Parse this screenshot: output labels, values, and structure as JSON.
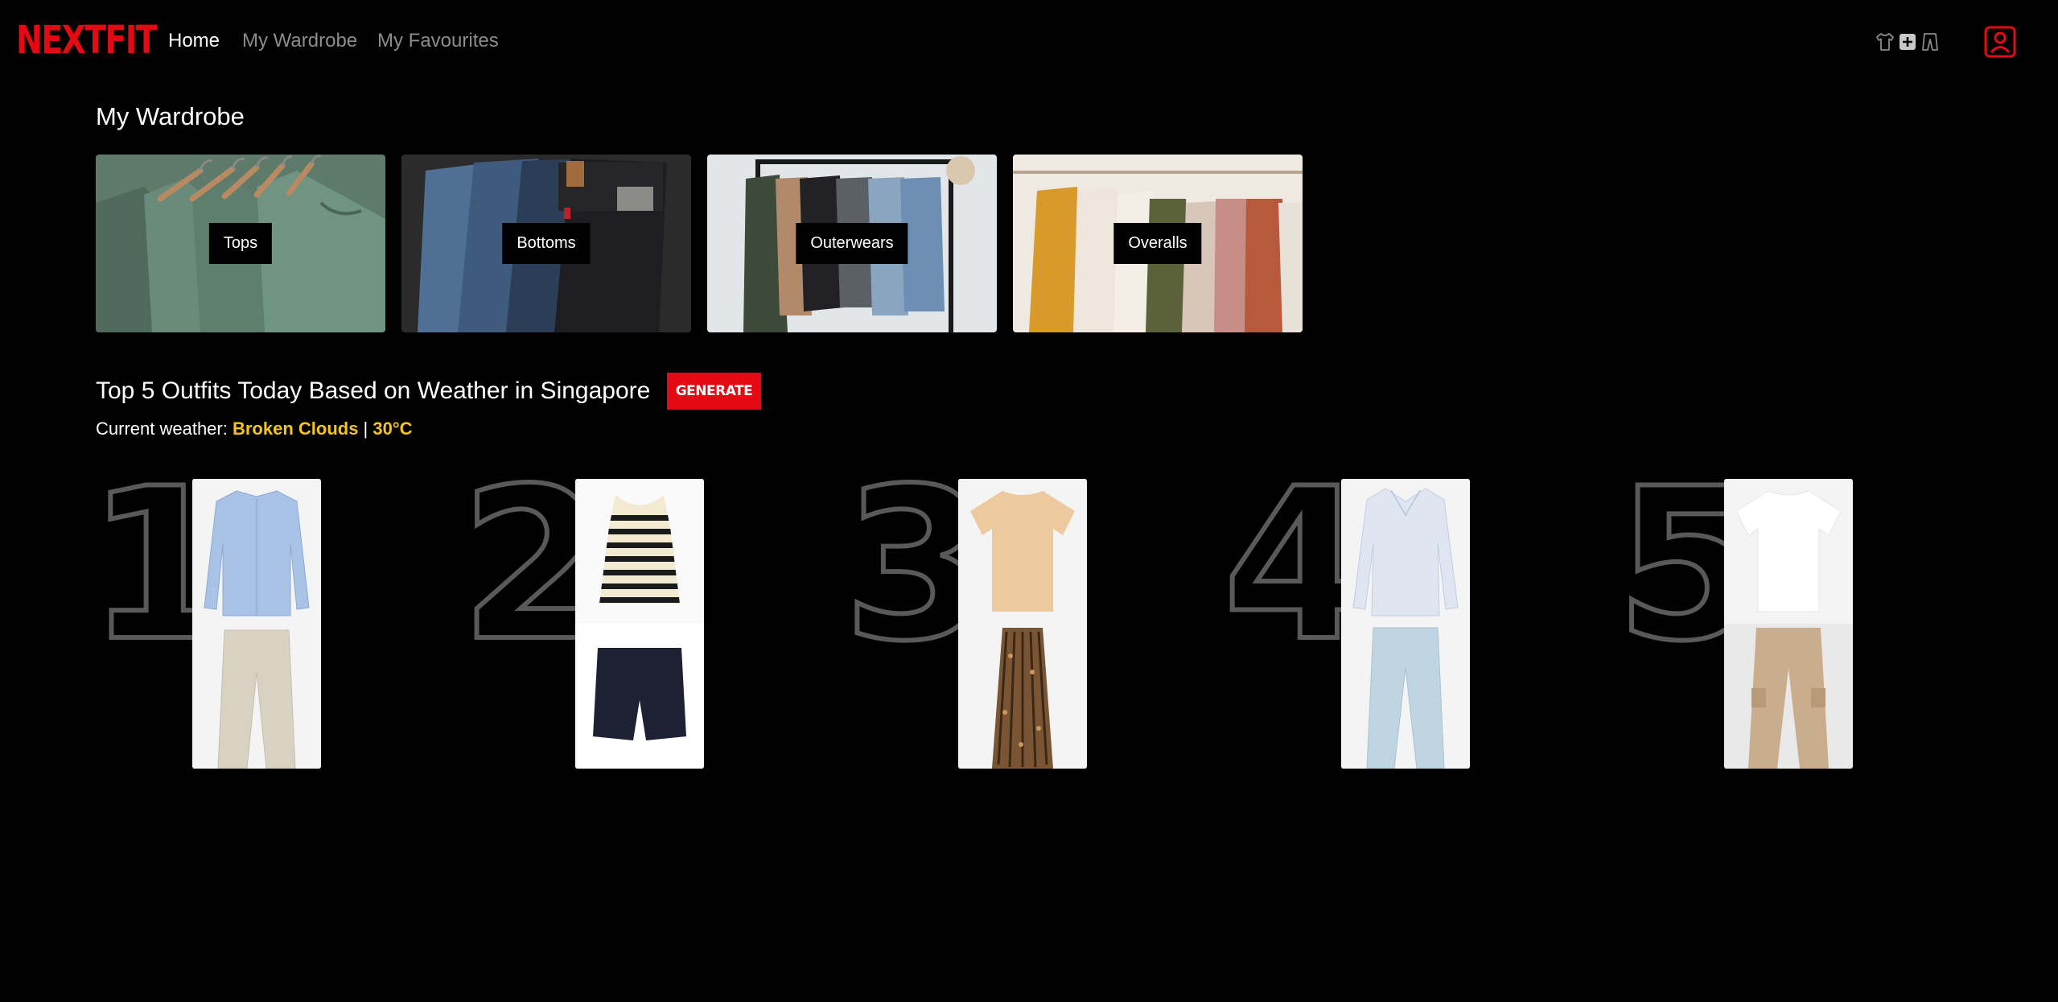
{
  "app": {
    "logo": "NEXTFIT"
  },
  "nav": {
    "links": [
      "Home",
      "My Wardrobe",
      "My Favourites"
    ],
    "active": "Home",
    "icons": [
      "tshirt-icon",
      "add-icon",
      "pants-icon",
      "user-profile-icon"
    ]
  },
  "wardrobe": {
    "title": "My Wardrobe",
    "categories": [
      {
        "label": "Tops",
        "image": "green t-shirts on hangers"
      },
      {
        "label": "Bottoms",
        "image": "stack of jeans"
      },
      {
        "label": "Outerwears",
        "image": "jackets on clothing rack"
      },
      {
        "label": "Overalls",
        "image": "dresses on hangers"
      }
    ]
  },
  "outfits": {
    "title": "Top 5 Outfits Today Based on Weather in Singapore",
    "generate_label": "GENERATE",
    "weather_prefix": "Current weather: ",
    "weather_condition": "Broken Clouds",
    "weather_separator": " | ",
    "weather_temp": "30°C",
    "items": [
      {
        "rank": "1",
        "top": "light blue button-up shirt",
        "bottom": "beige trousers"
      },
      {
        "rank": "2",
        "top": "striped tank top",
        "bottom": "navy shorts"
      },
      {
        "rank": "3",
        "top": "beige t-shirt",
        "bottom": "leopard print pleated skirt"
      },
      {
        "rank": "4",
        "top": "light blue blouse",
        "bottom": "light wash jeans"
      },
      {
        "rank": "5",
        "top": "white t-shirt",
        "bottom": "khaki cargo pants"
      }
    ]
  },
  "colors": {
    "brand": "#e50914",
    "highlight": "#f5c518",
    "background": "#000000"
  }
}
